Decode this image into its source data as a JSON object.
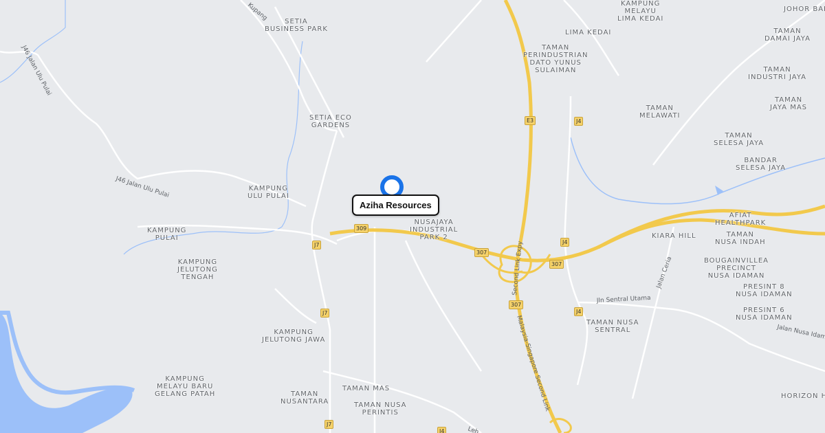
{
  "map": {
    "marker": {
      "label": "Aziha Resources",
      "color": "#1a73e8"
    },
    "places": [
      {
        "key": "setia-business-park",
        "text": "SETIA\nBUSINESS PARK"
      },
      {
        "key": "kampung-melayu-lima-kedai",
        "text": "KAMPUNG\nMELAYU\nLIMA KEDAI"
      },
      {
        "key": "johor-bahru",
        "text": "JOHOR BAH"
      },
      {
        "key": "lima-kedai",
        "text": "LIMA KEDAI"
      },
      {
        "key": "taman-damai-jaya",
        "text": "TAMAN\nDAMAI JAYA"
      },
      {
        "key": "taman-perindustrian-dato-yunus",
        "text": "TAMAN\nPERINDUSTRIAN\nDATO YUNUS\nSULAIMAN"
      },
      {
        "key": "taman-industri-jaya",
        "text": "TAMAN\nINDUSTRI JAYA"
      },
      {
        "key": "taman-jaya-mas",
        "text": "TAMAN\nJAYA MAS"
      },
      {
        "key": "taman-melawati",
        "text": "TAMAN\nMELAWATI"
      },
      {
        "key": "setia-eco-gardens",
        "text": "SETIA ECO\nGARDENS"
      },
      {
        "key": "taman-selesa-jaya",
        "text": "TAMAN\nSELESA JAYA"
      },
      {
        "key": "bandar-selesa-jaya",
        "text": "BANDAR\nSELESA JAYA"
      },
      {
        "key": "kampung-ulu-pulai",
        "text": "KAMPUNG\nULU PULAI"
      },
      {
        "key": "afiat-healthpark",
        "text": "AFIAT\nHEALTHPARK"
      },
      {
        "key": "nusajaya-industrial-park-2",
        "text": "NUSAJAYA\nINDUSTRIAL\nPARK 2"
      },
      {
        "key": "kampung-pulai",
        "text": "KAMPUNG\nPULAI"
      },
      {
        "key": "kiara-hill",
        "text": "KIARA HILL"
      },
      {
        "key": "taman-nusa-indah",
        "text": "TAMAN\nNUSA INDAH"
      },
      {
        "key": "kampung-jelutong-tengah",
        "text": "KAMPUNG\nJELUTONG\nTENGAH"
      },
      {
        "key": "bougainvillea-precinct",
        "text": "BOUGAINVILLEA\nPRECINCT\nNUSA IDAMAN"
      },
      {
        "key": "presint-8",
        "text": "PRESINT 8\nNUSA IDAMAN"
      },
      {
        "key": "presint-6",
        "text": "PRESINT 6\nNUSA IDAMAN"
      },
      {
        "key": "taman-nusa-sentral",
        "text": "TAMAN NUSA\nSENTRAL"
      },
      {
        "key": "kampung-jelutong-jawa",
        "text": "KAMPUNG\nJELUTONG JAWA"
      },
      {
        "key": "kampung-melayu-baru",
        "text": "KAMPUNG\nMELAYU BARU\nGELANG PATAH"
      },
      {
        "key": "taman-nusantara",
        "text": "TAMAN\nNUSANTARA"
      },
      {
        "key": "taman-mas",
        "text": "TAMAN MAS"
      },
      {
        "key": "taman-nusa-perintis",
        "text": "TAMAN NUSA\nPERINTIS"
      },
      {
        "key": "horizon-hills",
        "text": "HORIZON HI"
      }
    ],
    "road_labels": {
      "kupang": "Kupang",
      "j46_north": "J46 Jalan Ulu Pulai",
      "j46_south": "J46 Jalan Ulu Pulai",
      "second_link_expy": "Second Link Expy",
      "malaysia_singapore": "Malaysia-Singapore Second Link",
      "jln_sentral_utama": "Jln Sentral Utama",
      "jalan_ceria": "Jalan Ceria",
      "jalan_nusa_idaman": "Jalan Nusa Idaman",
      "leh": "Leh"
    },
    "shields": [
      {
        "key": "e3",
        "text": "E3"
      },
      {
        "key": "j4-top",
        "text": "J4"
      },
      {
        "key": "309",
        "text": "309"
      },
      {
        "key": "j7-top",
        "text": "J7"
      },
      {
        "key": "307-a",
        "text": "307"
      },
      {
        "key": "j4-mid",
        "text": "J4"
      },
      {
        "key": "307-b",
        "text": "307"
      },
      {
        "key": "307-c",
        "text": "307"
      },
      {
        "key": "j4-low",
        "text": "J4"
      },
      {
        "key": "j7-mid",
        "text": "J7"
      },
      {
        "key": "j7-bottom",
        "text": "J7"
      },
      {
        "key": "j4-bottom",
        "text": "J4"
      }
    ]
  }
}
